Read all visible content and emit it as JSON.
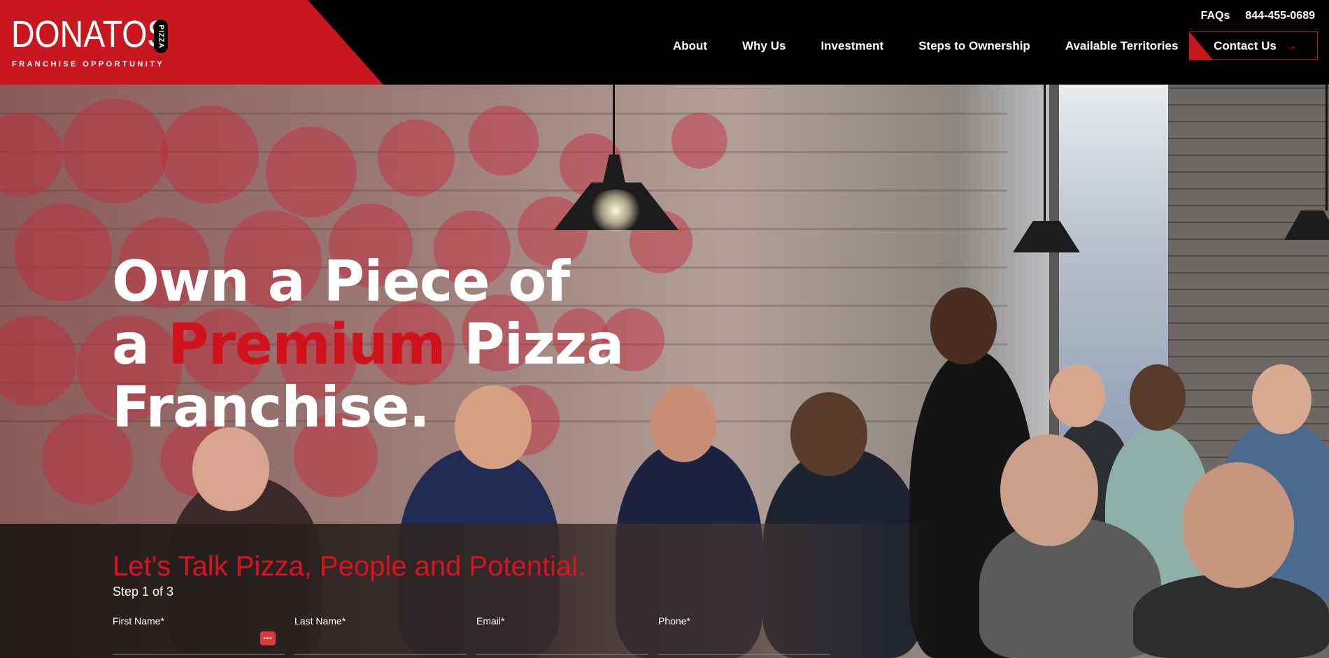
{
  "brand": {
    "name": "DONATOS",
    "pill": "PIZZA",
    "tagline": "FRANCHISE OPPORTUNITY",
    "accent_color": "#c8171e"
  },
  "utility": {
    "faqs": "FAQs",
    "phone": "844-455-0689"
  },
  "nav": {
    "items": [
      {
        "label": "About"
      },
      {
        "label": "Why Us"
      },
      {
        "label": "Investment"
      },
      {
        "label": "Steps to Ownership"
      },
      {
        "label": "Available Territories"
      }
    ],
    "contact_label": "Contact Us",
    "contact_icon": "arrow-right-icon"
  },
  "hero": {
    "line1": "Own a Piece of",
    "line2_pre": "a",
    "line2_red": "Premium",
    "line2_post": "Pizza",
    "line3": "Franchise."
  },
  "form": {
    "title": "Let's Talk Pizza, People and Potential.",
    "step": "Step 1 of 3",
    "fields": [
      {
        "label": "First Name*"
      },
      {
        "label": "Last Name*"
      },
      {
        "label": "Email*"
      },
      {
        "label": "Phone*"
      }
    ],
    "autofill_icon": "password-manager-icon"
  }
}
